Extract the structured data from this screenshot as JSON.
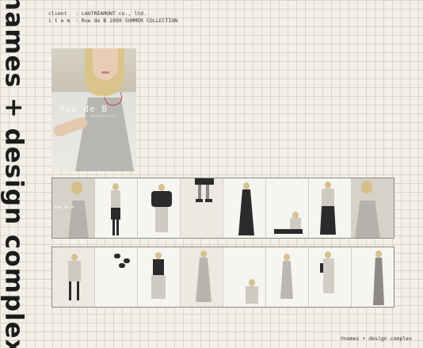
{
  "side_title": "names + design complex",
  "meta": {
    "client_key": "client",
    "client_value": ": LAUTRÉAMONT co., ltd.",
    "item_key": "i t e m",
    "item_value": ": Rue de B 1999 SUMMER COLLECTION"
  },
  "hero": {
    "title": "Rue de B",
    "subtitle": "1999 summer collection"
  },
  "footer": "©names + design complex"
}
